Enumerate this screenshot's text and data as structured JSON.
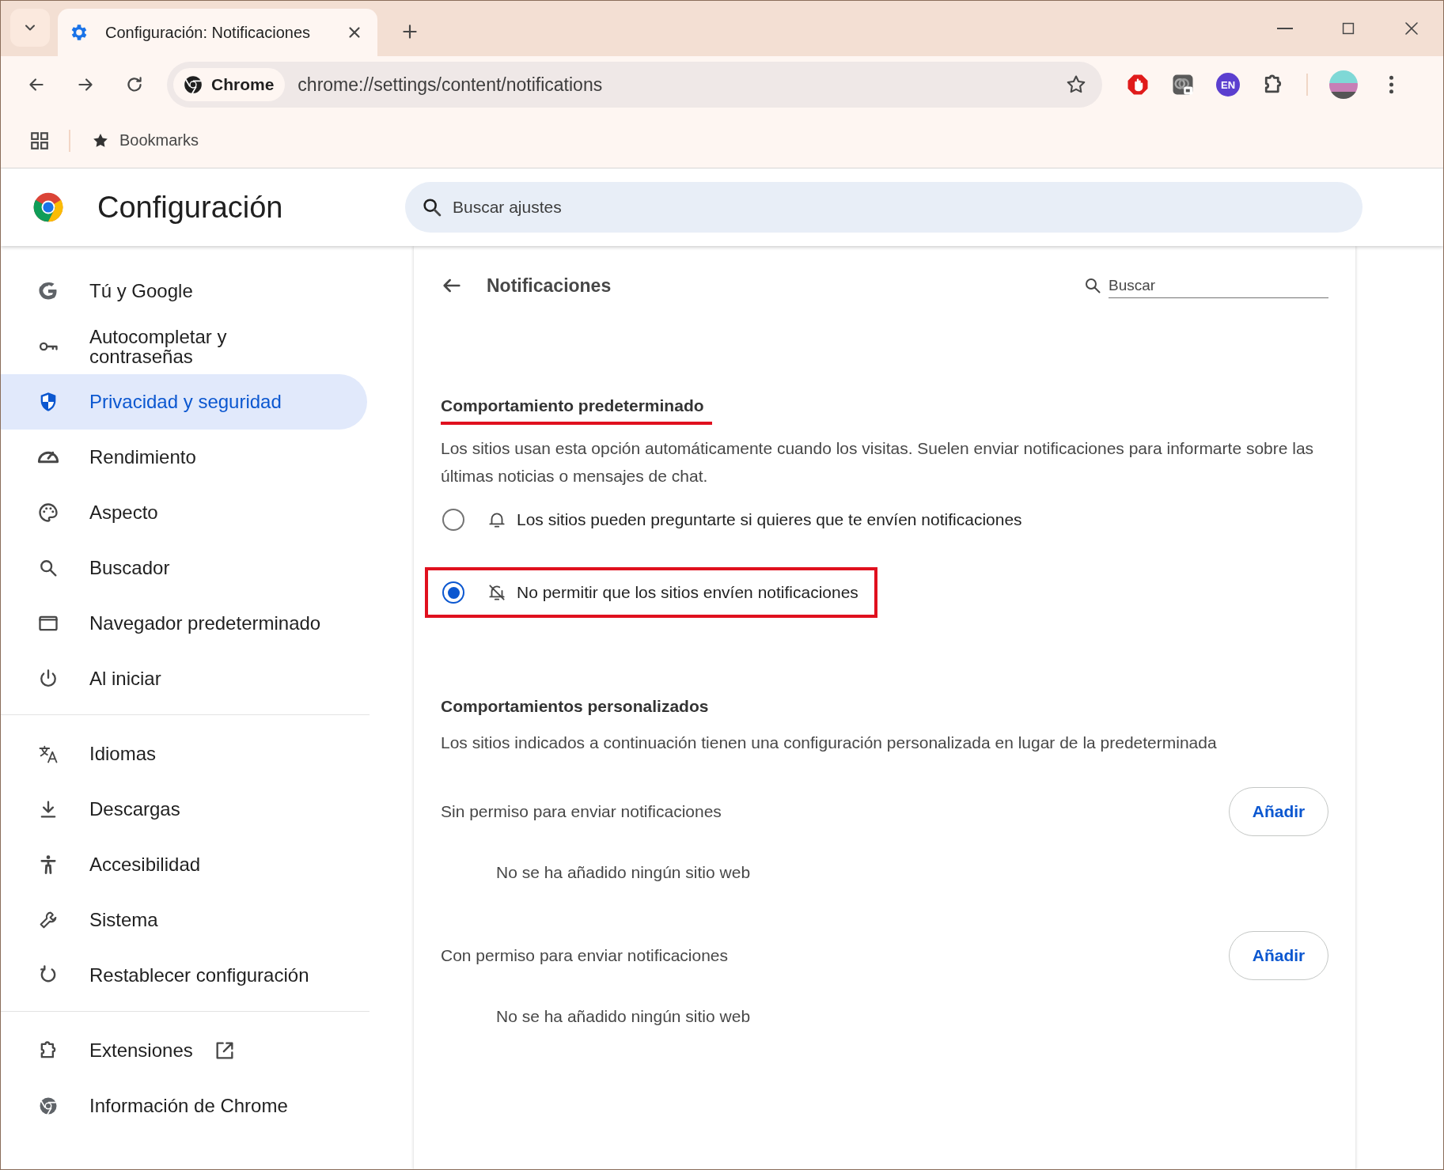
{
  "tab_strip": {
    "tabs": [
      {
        "title": "Configuración: Notificaciones",
        "selected": true
      }
    ]
  },
  "toolbar": {
    "site_chip": "Chrome",
    "url": "chrome://settings/content/notifications",
    "language_badge": "EN"
  },
  "bookmarks_bar": {
    "label": "Bookmarks"
  },
  "header": {
    "title": "Configuración",
    "search": {
      "placeholder": "Buscar ajustes"
    }
  },
  "sidebar": {
    "groups": [
      [
        {
          "label": "Tú y Google",
          "selected": false
        },
        {
          "label": "Autocompletar y contraseñas",
          "selected": false
        },
        {
          "label": "Privacidad y seguridad",
          "selected": true
        },
        {
          "label": "Rendimiento",
          "selected": false
        },
        {
          "label": "Aspecto",
          "selected": false
        },
        {
          "label": "Buscador",
          "selected": false
        },
        {
          "label": "Navegador predeterminado",
          "selected": false
        },
        {
          "label": "Al iniciar",
          "selected": false
        }
      ],
      [
        {
          "label": "Idiomas",
          "selected": false
        },
        {
          "label": "Descargas",
          "selected": false
        },
        {
          "label": "Accesibilidad",
          "selected": false
        },
        {
          "label": "Sistema",
          "selected": false
        },
        {
          "label": "Restablecer configuración",
          "selected": false
        }
      ],
      [
        {
          "label": "Extensiones",
          "selected": false,
          "external": true
        },
        {
          "label": "Información de Chrome",
          "selected": false,
          "external": false
        }
      ]
    ]
  },
  "page": {
    "title": "Notificaciones",
    "search": {
      "placeholder": "Buscar"
    },
    "default_behavior": {
      "heading": "Comportamiento predeterminado",
      "highlighted": true,
      "description": "Los sitios usan esta opción automáticamente cuando los visitas. Suelen enviar notificaciones para informarte sobre las últimas noticias o mensajes de chat.",
      "options": [
        {
          "kind": "allow",
          "label": "Los sitios pueden preguntarte si quieres que te envíen notificaciones",
          "selected": false,
          "highlighted": false
        },
        {
          "kind": "block",
          "label": "No permitir que los sitios envíen notificaciones",
          "selected": true,
          "highlighted": true
        }
      ]
    },
    "custom_behaviors": {
      "heading": "Comportamientos personalizados",
      "description": "Los sitios indicados a continuación tienen una configuración personalizada en lugar de la predeterminada",
      "lists": [
        {
          "label": "Sin permiso para enviar notificaciones",
          "button": "Añadir",
          "empty": "No se ha añadido ningún sitio web"
        },
        {
          "label": "Con permiso para enviar notificaciones",
          "button": "Añadir",
          "empty": "No se ha añadido ningún sitio web"
        }
      ]
    }
  }
}
